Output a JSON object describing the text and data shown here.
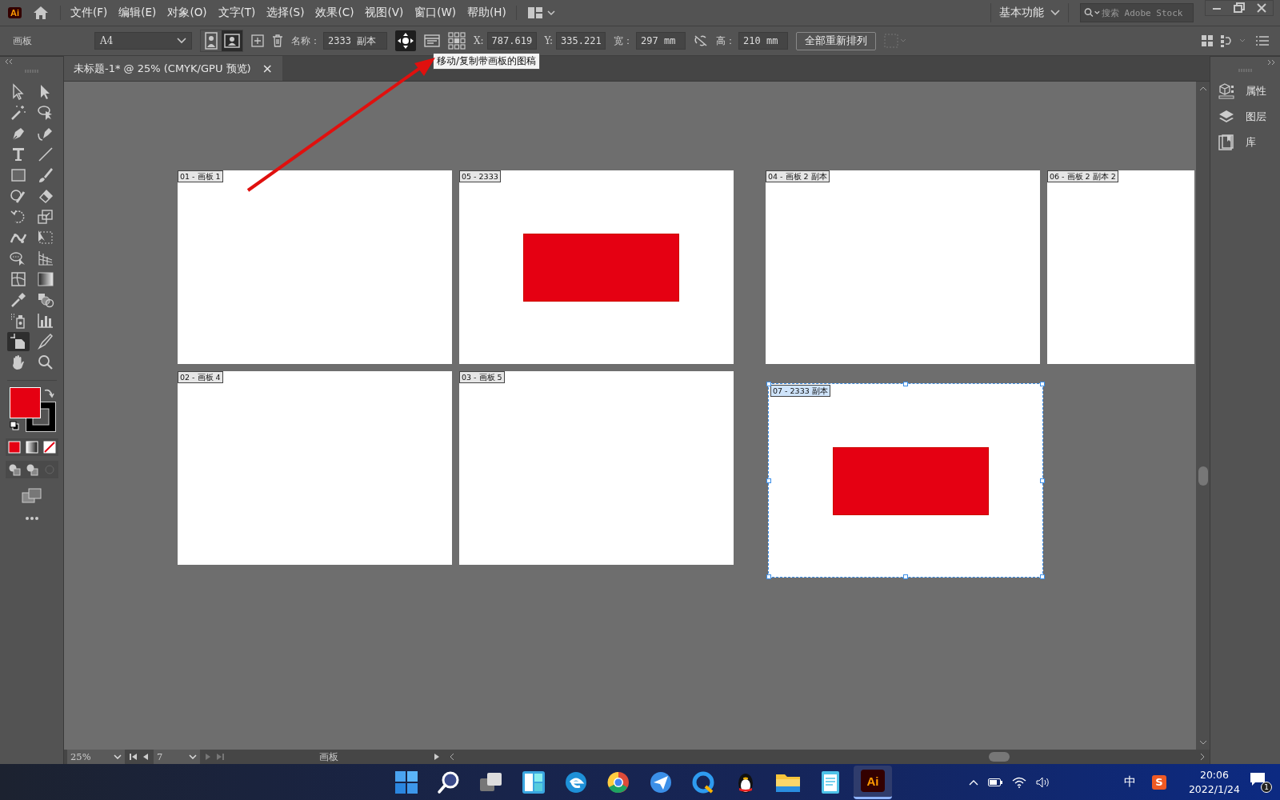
{
  "app_logo": "Ai",
  "menu": [
    "文件(F)",
    "编辑(E)",
    "对象(O)",
    "文字(T)",
    "选择(S)",
    "效果(C)",
    "视图(V)",
    "窗口(W)",
    "帮助(H)"
  ],
  "workspace": "基本功能",
  "search": {
    "placeholder": "搜索 Adobe Stock"
  },
  "control_bar": {
    "panel_label": "画板",
    "preset": "A4",
    "orientation": [
      {
        "kind": "portrait",
        "selected": false
      },
      {
        "kind": "landscape",
        "selected": true
      }
    ],
    "name_label": "名称：",
    "name_value": "2333 副本",
    "move_with_artboard": true,
    "x_label": "X:",
    "x_value": "787.619",
    "y_label": "Y:",
    "y_value": "335.221",
    "w_label": "宽：",
    "w_value": "297 mm",
    "h_label": "高：",
    "h_value": "210 mm",
    "rearrange_button": "全部重新排列"
  },
  "tooltip": "移动/复制带画板的图稿",
  "document_tab": {
    "title": "未标题-1* @ 25% (CMYK/GPU 预览)",
    "close": "×"
  },
  "tools": [
    {
      "kind": "selection",
      "selected": false
    },
    {
      "kind": "direct-selection",
      "selected": false
    },
    {
      "kind": "wand",
      "selected": false
    },
    {
      "kind": "lasso",
      "selected": false
    },
    {
      "kind": "pen",
      "selected": false
    },
    {
      "kind": "curvature",
      "selected": false
    },
    {
      "kind": "type",
      "selected": false
    },
    {
      "kind": "line",
      "selected": false
    },
    {
      "kind": "rectangle",
      "selected": false
    },
    {
      "kind": "brush",
      "selected": false
    },
    {
      "kind": "shaper",
      "selected": false
    },
    {
      "kind": "eraser",
      "selected": false
    },
    {
      "kind": "rotate",
      "selected": false
    },
    {
      "kind": "scale",
      "selected": false
    },
    {
      "kind": "warp",
      "selected": false
    },
    {
      "kind": "free-transform",
      "selected": false
    },
    {
      "kind": "shape-builder",
      "selected": false
    },
    {
      "kind": "perspective",
      "selected": false
    },
    {
      "kind": "mesh",
      "selected": false
    },
    {
      "kind": "gradient",
      "selected": false
    },
    {
      "kind": "eyedropper",
      "selected": false
    },
    {
      "kind": "blend",
      "selected": false
    },
    {
      "kind": "sprayer",
      "selected": false
    },
    {
      "kind": "graph",
      "selected": false
    },
    {
      "kind": "artboard",
      "selected": true
    },
    {
      "kind": "slice",
      "selected": false
    },
    {
      "kind": "hand",
      "selected": false
    },
    {
      "kind": "zoom",
      "selected": false
    }
  ],
  "artboards": [
    {
      "label": "01 - 画板 1",
      "selected": false
    },
    {
      "label": "05 - 2333",
      "selected": false,
      "shapes": [
        {
          "kind": "rectangle"
        }
      ]
    },
    {
      "label": "04 - 画板 2 副本",
      "selected": false
    },
    {
      "label": "06 - 画板 2 副本 2",
      "selected": false
    },
    {
      "label": "02 - 画板 4",
      "selected": false
    },
    {
      "label": "03 - 画板 5",
      "selected": false
    },
    {
      "label": "07 - 2333 副本",
      "selected": true,
      "shapes": [
        {
          "kind": "rectangle"
        }
      ]
    }
  ],
  "right_panel": [
    {
      "kind": "properties",
      "label": "属性"
    },
    {
      "kind": "layers",
      "label": "图层"
    },
    {
      "kind": "libraries",
      "label": "库"
    }
  ],
  "status_bar": {
    "zoom": "25%",
    "artboard_number": "7",
    "tool_name": "画板"
  },
  "taskbar": {
    "apps": [
      {
        "kind": "start",
        "active": false
      },
      {
        "kind": "search",
        "active": false
      },
      {
        "kind": "task-view",
        "active": false
      },
      {
        "kind": "widgets",
        "active": false
      },
      {
        "kind": "edge",
        "active": false
      },
      {
        "kind": "chrome",
        "active": false
      },
      {
        "kind": "feishu",
        "active": false
      },
      {
        "kind": "qq-browser",
        "active": false
      },
      {
        "kind": "penguin",
        "active": false
      },
      {
        "kind": "folder",
        "active": false
      },
      {
        "kind": "notepad",
        "active": false
      },
      {
        "kind": "illustrator",
        "active": true,
        "label": "Ai"
      }
    ],
    "ime": "中",
    "sogou": "S",
    "time": "20:06",
    "date": "2022/1/24",
    "notifications": "1"
  }
}
